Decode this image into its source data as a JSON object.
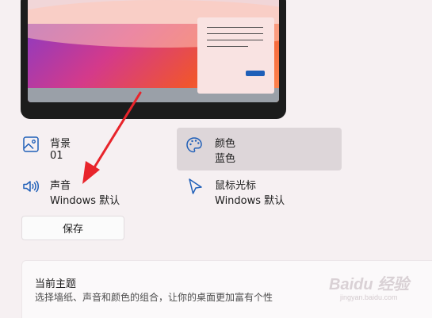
{
  "settings": {
    "background": {
      "title": "背景",
      "value": "01",
      "icon": "image-icon"
    },
    "color": {
      "title": "颜色",
      "value": "蓝色",
      "icon": "palette-icon"
    },
    "sound": {
      "title": "声音",
      "value": "Windows 默认",
      "icon": "speaker-icon"
    },
    "cursor": {
      "title": "鼠标光标",
      "value": "Windows 默认",
      "icon": "cursor-icon"
    }
  },
  "save_button": {
    "label": "保存"
  },
  "current_theme": {
    "title": "当前主题",
    "subtitle": "选择墙纸、声音和颜色的组合，让你的桌面更加富有个性"
  },
  "watermark": {
    "text": "Baidu 经验",
    "url": "jingyan.baidu.com"
  },
  "colors": {
    "accent": "#1f5fb8",
    "annotation_arrow": "#e8242b",
    "selected_bg": "#ddd6d9",
    "page_bg": "#f6f0f2"
  }
}
